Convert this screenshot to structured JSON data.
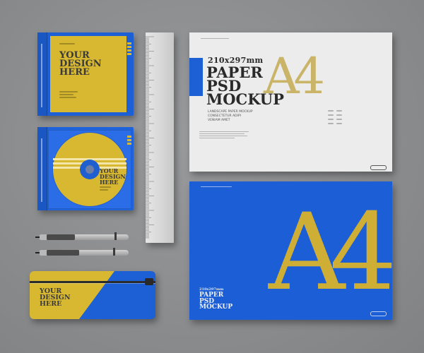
{
  "cd_case": {
    "cover_text": "YOUR\nDESIGN\nHERE"
  },
  "cd_disc": {
    "text": "YOUR\nDESIGN\nHERE"
  },
  "paper_white": {
    "dimensions": "210x297mm",
    "title": "PAPER\nPSD\nMOCKUP",
    "big_letters": "A4",
    "subtitle_lines": [
      "LANDSCAPE PAPER MOCKUP",
      "CONSECTETUR ADIPI",
      "VENIAM AMET"
    ]
  },
  "paper_blue": {
    "big_letters": "A4",
    "dimensions": "210x297mm",
    "title": "PAPER\nPSD\nMOCKUP"
  },
  "pencil_case": {
    "text": "YOUR\nDESIGN\nHERE"
  },
  "colors": {
    "background": "#8d8d8f",
    "blue": "#1c5ed6",
    "yellow": "#d8b830",
    "white_paper": "#ececec",
    "ruler": "#dcdcdc"
  }
}
